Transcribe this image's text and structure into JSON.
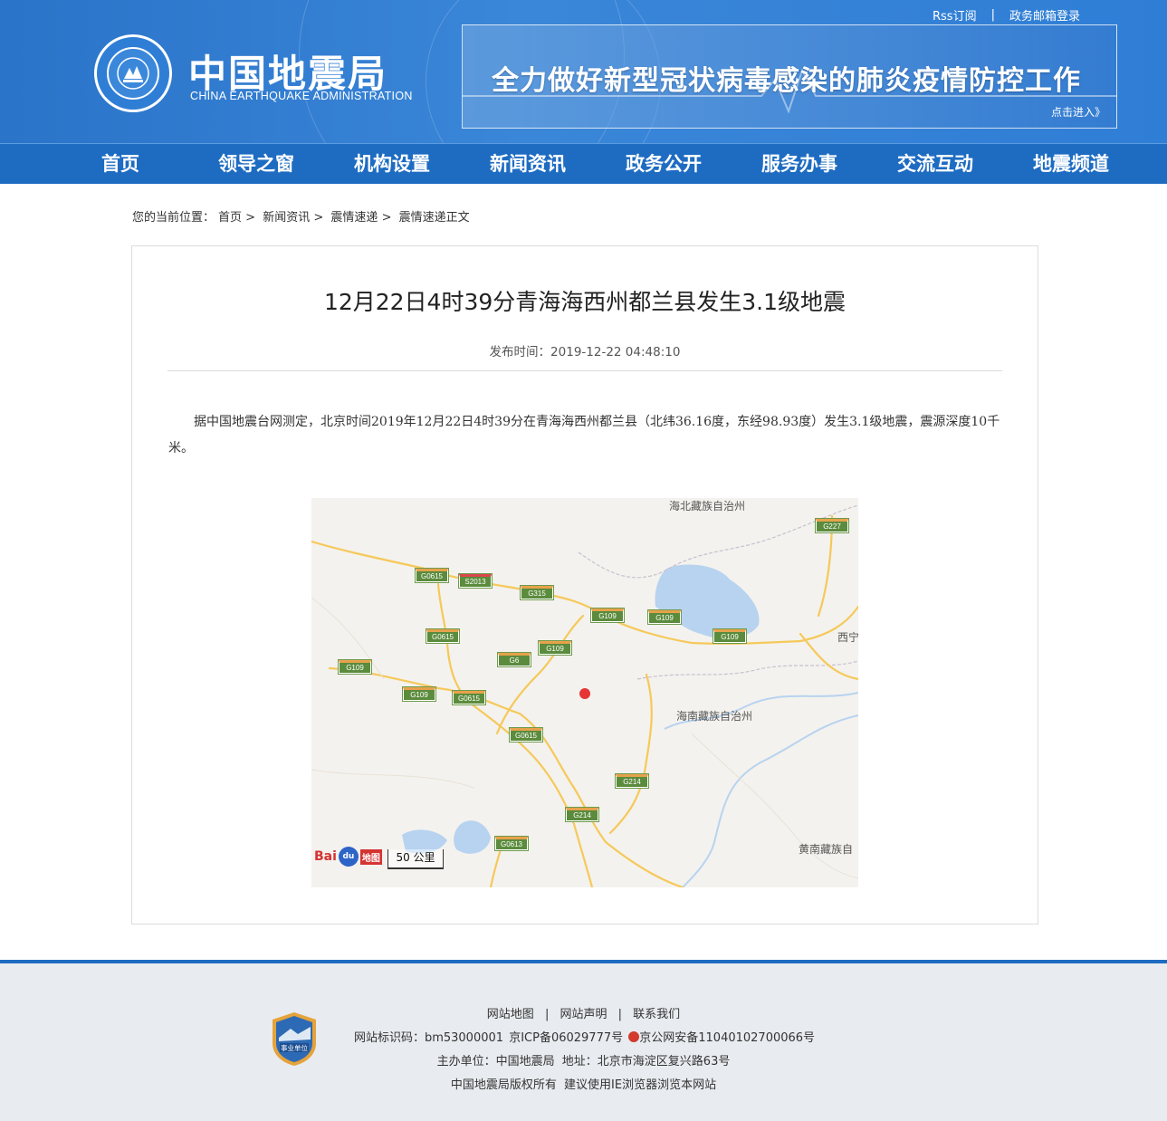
{
  "top_links": {
    "rss": "Rss订阅",
    "sep": "|",
    "mail": "政务邮箱登录"
  },
  "logo": {
    "cn": "中国地震局",
    "en": "CHINA EARTHQUAKE ADMINISTRATION",
    "emblem_text": "中国地震局"
  },
  "banner": {
    "title": "全力做好新型冠状病毒感染的肺炎疫情防控工作",
    "link": "点击进入》"
  },
  "nav": [
    "首页",
    "领导之窗",
    "机构设置",
    "新闻资讯",
    "政务公开",
    "服务办事",
    "交流互动",
    "地震频道"
  ],
  "breadcrumb": {
    "prefix": "您的当前位置：",
    "items": [
      "首页",
      "新闻资讯",
      "震情速递",
      "震情速递正文"
    ],
    "sep": ">"
  },
  "article": {
    "title": "12月22日4时39分青海海西州都兰县发生3.1级地震",
    "pubtime": "发布时间：2019-12-22 04:48:10",
    "body": "据中国地震台网测定，北京时间2019年12月22日4时39分在青海海西州都兰县（北纬36.16度，东经98.93度）发生3.1级地震，震源深度10千米。"
  },
  "map": {
    "labels": {
      "north": "海北藏族自治州",
      "xining": "西宁",
      "hainan": "海南藏族自治州",
      "huangnan": "黄南藏族自"
    },
    "roads": [
      "G227",
      "G0615",
      "S2013",
      "G315",
      "G109",
      "G109",
      "G109",
      "G0615",
      "G109",
      "G6",
      "G109",
      "G109",
      "G0615",
      "G0615",
      "G214",
      "G214",
      "G0613"
    ],
    "scale": "50 公里",
    "brand": {
      "bai": "Bai",
      "du": "du",
      "ditu": "地图"
    }
  },
  "footer": {
    "links": [
      "网站地图",
      "网站声明",
      "联系我们"
    ],
    "sep": "|",
    "line1": [
      "网站标识码：bm53000001",
      "京ICP备06029777号",
      "京公网安备11040102700066号"
    ],
    "line2": [
      "主办单位：中国地震局",
      "地址：北京市海淀区复兴路63号"
    ],
    "line3": [
      "中国地震局版权所有",
      "建议使用IE浏览器浏览本网站"
    ],
    "badge_text": "事业单位"
  }
}
